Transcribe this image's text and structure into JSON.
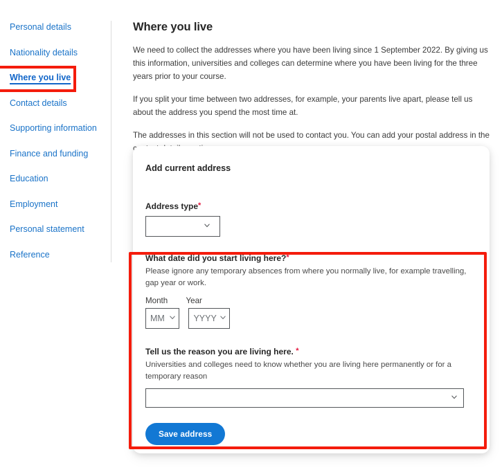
{
  "sidebar": {
    "items": [
      {
        "label": "Personal details",
        "active": false
      },
      {
        "label": "Nationality details",
        "active": false
      },
      {
        "label": "Where you live",
        "active": true
      },
      {
        "label": "Contact details",
        "active": false
      },
      {
        "label": "Supporting information",
        "active": false
      },
      {
        "label": "Finance and funding",
        "active": false
      },
      {
        "label": "Education",
        "active": false
      },
      {
        "label": "Employment",
        "active": false
      },
      {
        "label": "Personal statement",
        "active": false
      },
      {
        "label": "Reference",
        "active": false
      }
    ]
  },
  "main": {
    "title": "Where you live",
    "paragraphs": [
      "We need to collect the addresses where you have been living since 1 September 2022. By giving us this information, universities and colleges can determine where you have been living for the three years prior to your course.",
      "If you split your time between two addresses, for example, your parents live apart, please tell us about the address you spend the most time at.",
      "The addresses in this section will not be used to contact you. You can add your postal address in the contact details section."
    ]
  },
  "card": {
    "title": "Add current address",
    "address_type": {
      "label": "Address type",
      "required_marker": "*",
      "value": "",
      "chevron_icon": "chevron-down-icon"
    },
    "start_date": {
      "label": "What date did you start living here?",
      "required_marker": "*",
      "help": "Please ignore any temporary absences from where you normally live, for example travelling, gap year or work.",
      "month_label": "Month",
      "year_label": "Year",
      "month_value": "MM",
      "year_value": "YYYY",
      "chevron_icon": "chevron-down-icon"
    },
    "reason": {
      "label": "Tell us the reason you are living here.",
      "required_marker": "*",
      "help": "Universities and colleges need to know whether you are living here permanently or for a temporary reason",
      "value": "",
      "chevron_icon": "chevron-down-icon"
    },
    "save_label": "Save address"
  },
  "colors": {
    "link": "#1a73c8",
    "active_link": "#1266c9",
    "required": "#e3173e",
    "button": "#1278d4",
    "annotation": "#f41c0c",
    "border": "#54575a",
    "text": "#262626"
  }
}
